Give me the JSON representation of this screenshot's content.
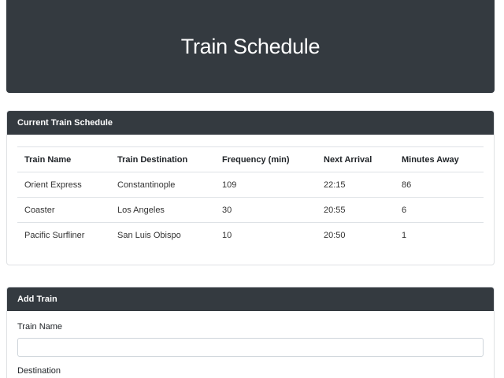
{
  "header": {
    "title": "Train Schedule"
  },
  "schedule": {
    "title": "Current Train Schedule",
    "columns": [
      "Train Name",
      "Train Destination",
      "Frequency (min)",
      "Next Arrival",
      "Minutes Away"
    ],
    "rows": [
      [
        "Orient Express",
        "Constantinople",
        "109",
        "22:15",
        "86"
      ],
      [
        "Coaster",
        "Los Angeles",
        "30",
        "20:55",
        "6"
      ],
      [
        "Pacific Surfliner",
        "San Luis Obispo",
        "10",
        "20:50",
        "1"
      ]
    ]
  },
  "add_train": {
    "title": "Add Train",
    "train_name_label": "Train Name",
    "train_name_value": "",
    "destination_label": "Destination"
  }
}
